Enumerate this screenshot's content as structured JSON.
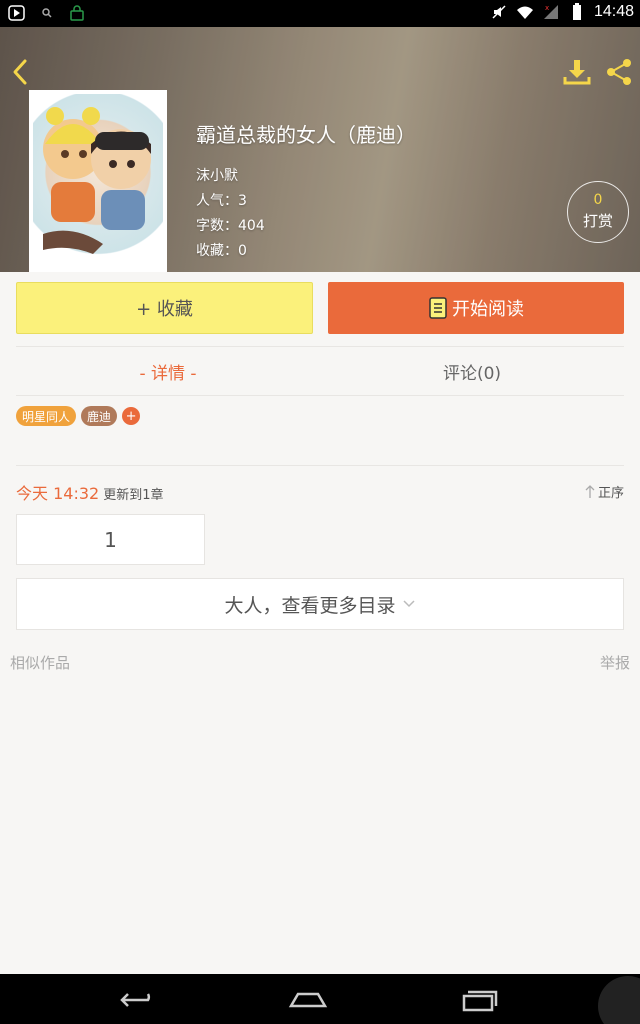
{
  "status_bar": {
    "time": "14:48"
  },
  "book": {
    "title": "霸道总裁的女人（鹿迪）",
    "author": "沫小默",
    "popularity": "人气：3",
    "word_count": "字数：404",
    "favorites": "收藏：0"
  },
  "tip": {
    "count": "0",
    "label": "打赏"
  },
  "actions": {
    "collect_label": "+ 收藏",
    "read_label": "开始阅读"
  },
  "tabs": [
    {
      "label": "- 详情 -"
    },
    {
      "label": "评论(0)"
    }
  ],
  "tags": [
    {
      "label": "明星同人"
    },
    {
      "label": "鹿迪"
    }
  ],
  "tag_add_label": "+",
  "update": {
    "time": "今天 14:32",
    "text": "更新到1章",
    "sort_label": "正序"
  },
  "chapter": {
    "number": "1"
  },
  "more_label": "大人，查看更多目录",
  "footer": {
    "similar_label": "相似作品",
    "report_label": "举报"
  },
  "colors": {
    "accent": "#ea6a3b",
    "collect_bg": "#fbf17b",
    "tag_orange": "#f0a23c",
    "tag_brown": "#b07a5a"
  }
}
